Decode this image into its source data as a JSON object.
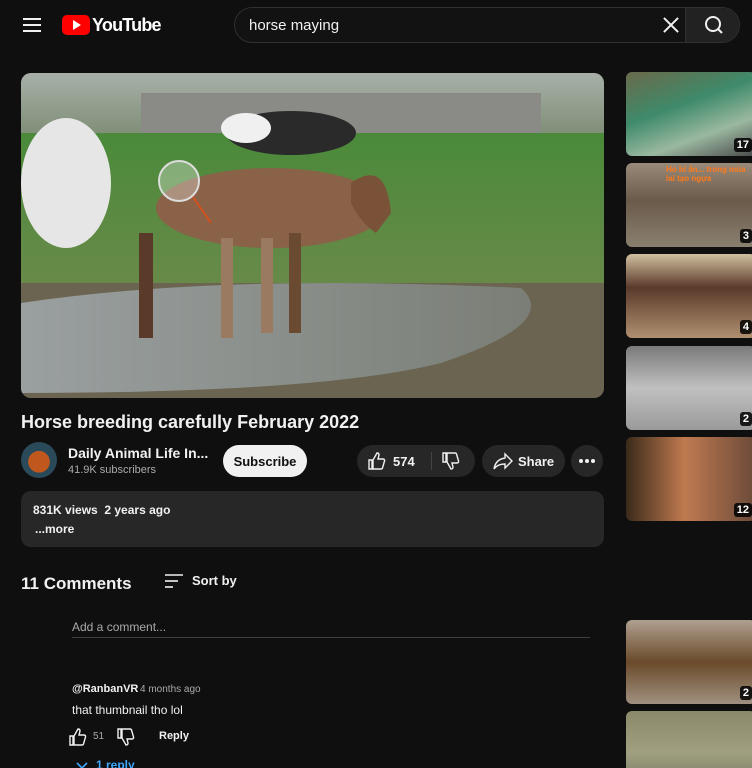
{
  "header": {
    "logo_text": "YouTube",
    "search_value": "horse maying",
    "icons": {
      "menu": "hamburger-icon",
      "clear": "close-icon",
      "search": "search-icon"
    }
  },
  "video": {
    "title": "Horse breeding carefully February 2022",
    "channel_name": "Daily Animal Life In...",
    "subscribers": "41.9K subscribers",
    "subscribe_label": "Subscribe",
    "like_count": "574",
    "share_label": "Share",
    "stats": "831K views  2 years ago",
    "more_label": "...more"
  },
  "comments": {
    "title": "11 Comments",
    "sort_label": "Sort by",
    "input_placeholder": "Add a comment...",
    "items": [
      {
        "author": "@RanbanVR",
        "time": "4 months ago",
        "text": "that thumbnail tho lol",
        "likes": "51",
        "reply_label": "Reply",
        "replies_label": "1 reply"
      }
    ]
  },
  "sidebar": {
    "thumbs": [
      {
        "duration": "17"
      },
      {
        "duration": "3",
        "caption": "Ho bí ẩn... trong mùa lai tạo ngựa"
      },
      {
        "duration": "4"
      },
      {
        "duration": "2"
      },
      {
        "duration": "12"
      },
      {
        "duration": "2"
      },
      {
        "duration": ""
      }
    ]
  },
  "colors": {
    "background": "#0f0f0f",
    "brand_red": "#ff0000",
    "link_blue": "#3ea6ff",
    "pill_bg": "#272727"
  }
}
